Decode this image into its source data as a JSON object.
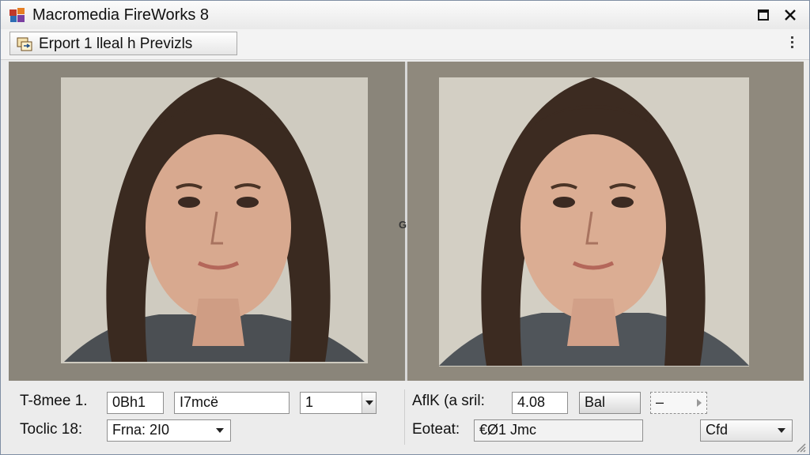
{
  "window": {
    "title": "Macromedia FireWorks 8"
  },
  "toolbar": {
    "tab_label": "Erport 1 lleal h Previzls"
  },
  "controls": {
    "left": {
      "row1_label": "T-8mee 1.",
      "row1_field1": "0Bh1",
      "row1_field2": "I7mcë",
      "row1_select": "1",
      "row2_label": "Toclic 18:",
      "row2_select": "Frna: 2I0"
    },
    "right": {
      "row1_label": "AflK (a sril:",
      "row1_value": "4.08",
      "row1_button": "Bal",
      "row1_stepper": "–",
      "row2_label": "Eoteat:",
      "row2_field": "€Ø1 Jmc",
      "row2_select": "Cfd"
    }
  },
  "divider": {
    "handle": "G"
  },
  "colors": {
    "accent": "#2f5f9c",
    "preview_bg": "#8d877b"
  }
}
